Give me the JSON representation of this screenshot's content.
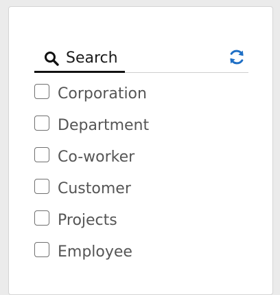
{
  "filter_panel": {
    "search_tab": {
      "label": "Search",
      "icon": "search-icon"
    },
    "refresh_icon": "refresh-icon",
    "accent_color": "#1f6fc5",
    "options": [
      {
        "label": "Corporation",
        "checked": false
      },
      {
        "label": "Department",
        "checked": false
      },
      {
        "label": "Co-worker",
        "checked": false
      },
      {
        "label": "Customer",
        "checked": false
      },
      {
        "label": "Projects",
        "checked": false
      },
      {
        "label": "Employee",
        "checked": false
      }
    ]
  }
}
